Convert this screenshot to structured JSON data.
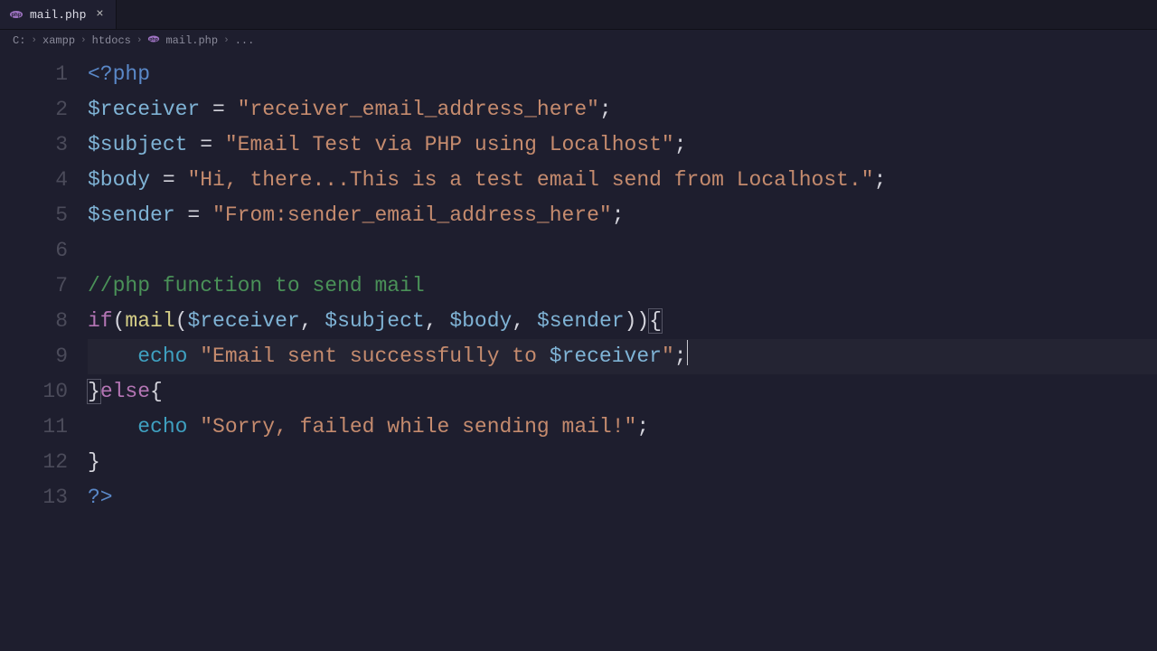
{
  "tab": {
    "filename": "mail.php",
    "icon": "php-file-icon"
  },
  "breadcrumbs": {
    "parts": [
      "C:",
      "xampp",
      "htdocs",
      "mail.php",
      "..."
    ],
    "file_index": 3
  },
  "editor": {
    "highlighted_line": 9,
    "lines": [
      {
        "n": 1,
        "tokens": [
          [
            "tag",
            "<?php"
          ]
        ]
      },
      {
        "n": 2,
        "tokens": [
          [
            "var",
            "$receiver"
          ],
          [
            "op",
            " = "
          ],
          [
            "str",
            "\"receiver_email_address_here\""
          ],
          [
            "op",
            ";"
          ]
        ]
      },
      {
        "n": 3,
        "tokens": [
          [
            "var",
            "$subject"
          ],
          [
            "op",
            " = "
          ],
          [
            "str",
            "\"Email Test via PHP using Localhost\""
          ],
          [
            "op",
            ";"
          ]
        ]
      },
      {
        "n": 4,
        "tokens": [
          [
            "var",
            "$body"
          ],
          [
            "op",
            " = "
          ],
          [
            "str",
            "\"Hi, there...This is a test email send from Localhost.\""
          ],
          [
            "op",
            ";"
          ]
        ]
      },
      {
        "n": 5,
        "tokens": [
          [
            "var",
            "$sender"
          ],
          [
            "op",
            " = "
          ],
          [
            "str",
            "\"From:sender_email_address_here\""
          ],
          [
            "op",
            ";"
          ]
        ]
      },
      {
        "n": 6,
        "tokens": []
      },
      {
        "n": 7,
        "tokens": [
          [
            "comment",
            "//php function to send mail"
          ]
        ]
      },
      {
        "n": 8,
        "tokens": [
          [
            "kw",
            "if"
          ],
          [
            "op",
            "("
          ],
          [
            "func",
            "mail"
          ],
          [
            "op",
            "("
          ],
          [
            "var",
            "$receiver"
          ],
          [
            "op",
            ", "
          ],
          [
            "var",
            "$subject"
          ],
          [
            "op",
            ", "
          ],
          [
            "var",
            "$body"
          ],
          [
            "op",
            ", "
          ],
          [
            "var",
            "$sender"
          ],
          [
            "op",
            "))"
          ],
          [
            "punc-match",
            "{"
          ]
        ]
      },
      {
        "n": 9,
        "tokens": [
          [
            "op",
            "    "
          ],
          [
            "builtin",
            "echo"
          ],
          [
            "op",
            " "
          ],
          [
            "str",
            "\"Email sent successfully to "
          ],
          [
            "strvar",
            "$receiver"
          ],
          [
            "str",
            "\""
          ],
          [
            "op",
            ";"
          ],
          [
            "cursor",
            ""
          ]
        ]
      },
      {
        "n": 10,
        "tokens": [
          [
            "punc-match",
            "}"
          ],
          [
            "kw",
            "else"
          ],
          [
            "op",
            "{"
          ]
        ]
      },
      {
        "n": 11,
        "tokens": [
          [
            "op",
            "    "
          ],
          [
            "builtin",
            "echo"
          ],
          [
            "op",
            " "
          ],
          [
            "str",
            "\"Sorry, failed while sending mail!\""
          ],
          [
            "op",
            ";"
          ]
        ]
      },
      {
        "n": 12,
        "tokens": [
          [
            "op",
            "}"
          ]
        ]
      },
      {
        "n": 13,
        "tokens": [
          [
            "tag",
            "?>"
          ]
        ]
      }
    ]
  }
}
